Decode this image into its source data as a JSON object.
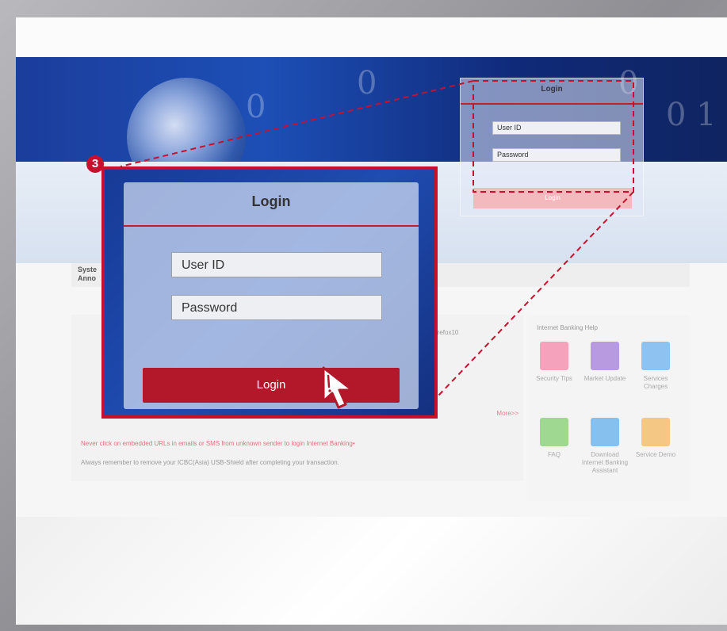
{
  "small_login": {
    "title": "Login",
    "user_id_placeholder": "User ID",
    "password_placeholder": "Password",
    "button_label": "Login"
  },
  "zoom_login": {
    "title": "Login",
    "user_id_placeholder": "User ID",
    "password_placeholder": "Password",
    "button_label": "Login"
  },
  "step_badge": "3",
  "announcement": {
    "line1": "Syste",
    "line2": "Anno"
  },
  "notices": {
    "more_link": "More>>",
    "line_browser": "Firefox10",
    "line_embedded": "Never click on embedded URLs in emails or SMS from unknown sender to login Internet Banking•",
    "line_shield": "Always remember to remove your ICBC(Asia) USB-Shield after completing your transaction."
  },
  "help": {
    "title": "Internet Banking Help",
    "items": [
      {
        "label": "Security Tips",
        "color": "#f27aa0"
      },
      {
        "label": "Market Update",
        "color": "#9a6fd2"
      },
      {
        "label": "Services Charges",
        "color": "#5aa8ea"
      },
      {
        "label": "FAQ",
        "color": "#6ec45a"
      },
      {
        "label": "Download Internet Banking Assistant",
        "color": "#4fa6e8"
      },
      {
        "label": "Service Demo",
        "color": "#f2a640"
      }
    ]
  },
  "colors": {
    "accent_red": "#c8102e",
    "banner_blue": "#1d4fb6"
  }
}
